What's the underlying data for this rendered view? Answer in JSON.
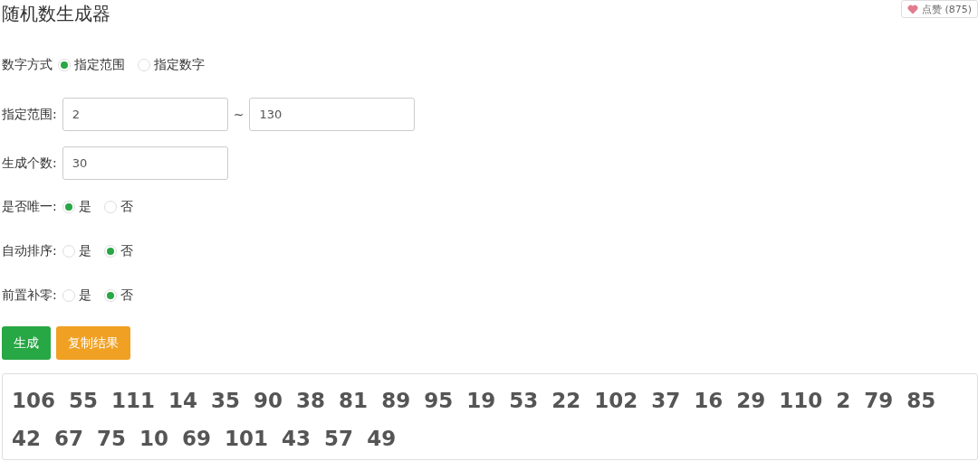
{
  "title": "随机数生成器",
  "like_button": {
    "label": "点赞 (875)"
  },
  "mode": {
    "label": "数字方式",
    "options": [
      {
        "label": "指定范围",
        "selected": true
      },
      {
        "label": "指定数字",
        "selected": false
      }
    ]
  },
  "range": {
    "label": "指定范围:",
    "from": "2",
    "separator": "~",
    "to": "130"
  },
  "count": {
    "label": "生成个数:",
    "value": "30"
  },
  "toggles": [
    {
      "label": "是否唯一:",
      "options": [
        {
          "label": "是",
          "selected": true
        },
        {
          "label": "否",
          "selected": false
        }
      ]
    },
    {
      "label": "自动排序:",
      "options": [
        {
          "label": "是",
          "selected": false
        },
        {
          "label": "否",
          "selected": true
        }
      ]
    },
    {
      "label": "前置补零:",
      "options": [
        {
          "label": "是",
          "selected": false
        },
        {
          "label": "否",
          "selected": true
        }
      ]
    }
  ],
  "buttons": [
    {
      "label": "生成",
      "kind": "primary"
    },
    {
      "label": "复制结果",
      "kind": "warning"
    }
  ],
  "result_lines": [
    [
      "106",
      "55",
      "111",
      "14",
      "35",
      "90",
      "38",
      "81",
      "89",
      "95",
      "19",
      "53",
      "22",
      "102",
      "37",
      "16",
      "29",
      "110",
      "2",
      "79",
      "85"
    ],
    [
      "42",
      "67",
      "75",
      "10",
      "69",
      "101",
      "43",
      "57",
      "49"
    ]
  ]
}
